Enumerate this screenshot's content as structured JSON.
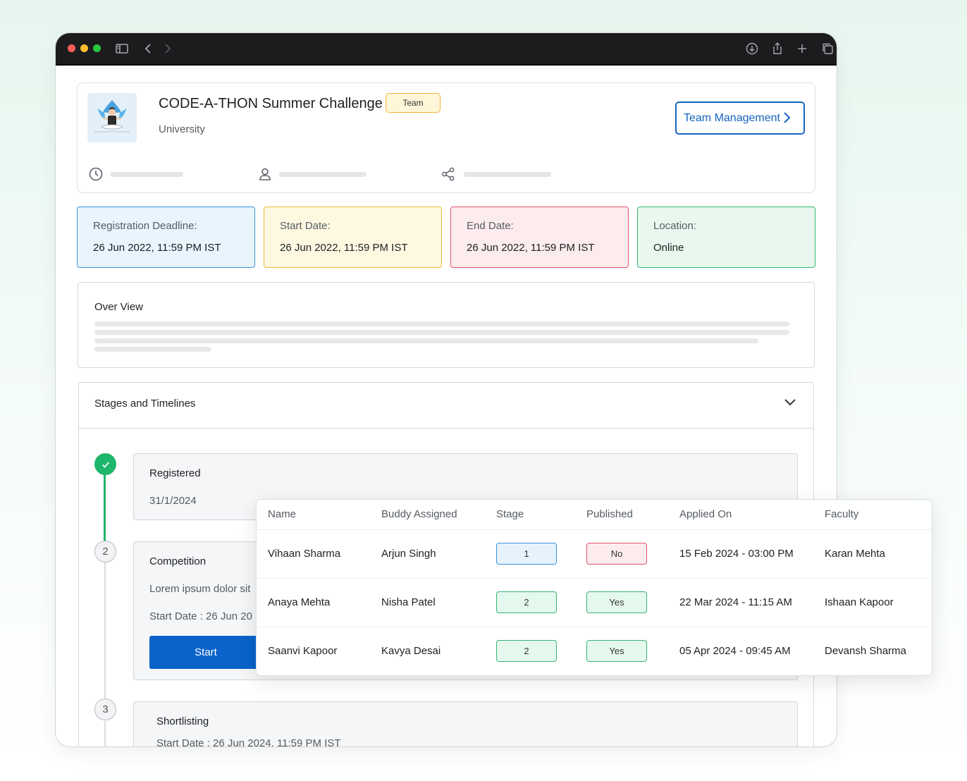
{
  "event": {
    "title": "CODE-A-THON Summer Challenge",
    "badge": "Team",
    "subtitle": "University",
    "team_management_label": "Team Management"
  },
  "info_cards": [
    {
      "label": "Registration Deadline:",
      "value": "26 Jun 2022, 11:59 PM IST",
      "color": "#3a8fd6"
    },
    {
      "label": "Start Date:",
      "value": "26 Jun 2022, 11:59 PM IST",
      "color": "#f1b53b"
    },
    {
      "label": "End Date:",
      "value": "26 Jun 2022, 11:59 PM IST",
      "color": "#e0526a"
    },
    {
      "label": "Location:",
      "value": "Online",
      "color": "#35b56f"
    }
  ],
  "overview": {
    "title": "Over View"
  },
  "stages": {
    "title": "Stages and Timelines",
    "items": [
      {
        "number": "",
        "status": "done",
        "title": "Registered",
        "date": "31/1/2024"
      },
      {
        "number": "2",
        "title": "Competition",
        "description": "Lorem ipsum dolor sit",
        "start_date": "Start Date :  26 Jun 20",
        "button": "Start"
      },
      {
        "number": "3",
        "title": "Shortlisting",
        "start_date": "Start Date :  26 Jun 2024, 11:59 PM IST"
      }
    ]
  },
  "table": {
    "columns": [
      "Name",
      "Buddy Assigned",
      "Stage",
      "Published",
      "Applied On",
      "Faculty"
    ],
    "rows": [
      {
        "name": "Vihaan Sharma",
        "buddy": "Arjun Singh",
        "stage": "1",
        "published": "No",
        "applied_on": "15 Feb 2024 - 03:00 PM",
        "faculty": "Karan Mehta"
      },
      {
        "name": "Anaya Mehta",
        "buddy": "Nisha Patel",
        "stage": "2",
        "published": "Yes",
        "applied_on": "22 Mar 2024 - 11:15 AM",
        "faculty": "Ishaan Kapoor"
      },
      {
        "name": "Saanvi Kapoor",
        "buddy": "Kavya Desai",
        "stage": "2",
        "published": "Yes",
        "applied_on": "05 Apr 2024 - 09:45 AM",
        "faculty": "Devansh Sharma"
      }
    ]
  },
  "colors": {
    "primary": "#1565c0",
    "success": "#1eb66b",
    "titlebar": "#1c1c1e"
  }
}
